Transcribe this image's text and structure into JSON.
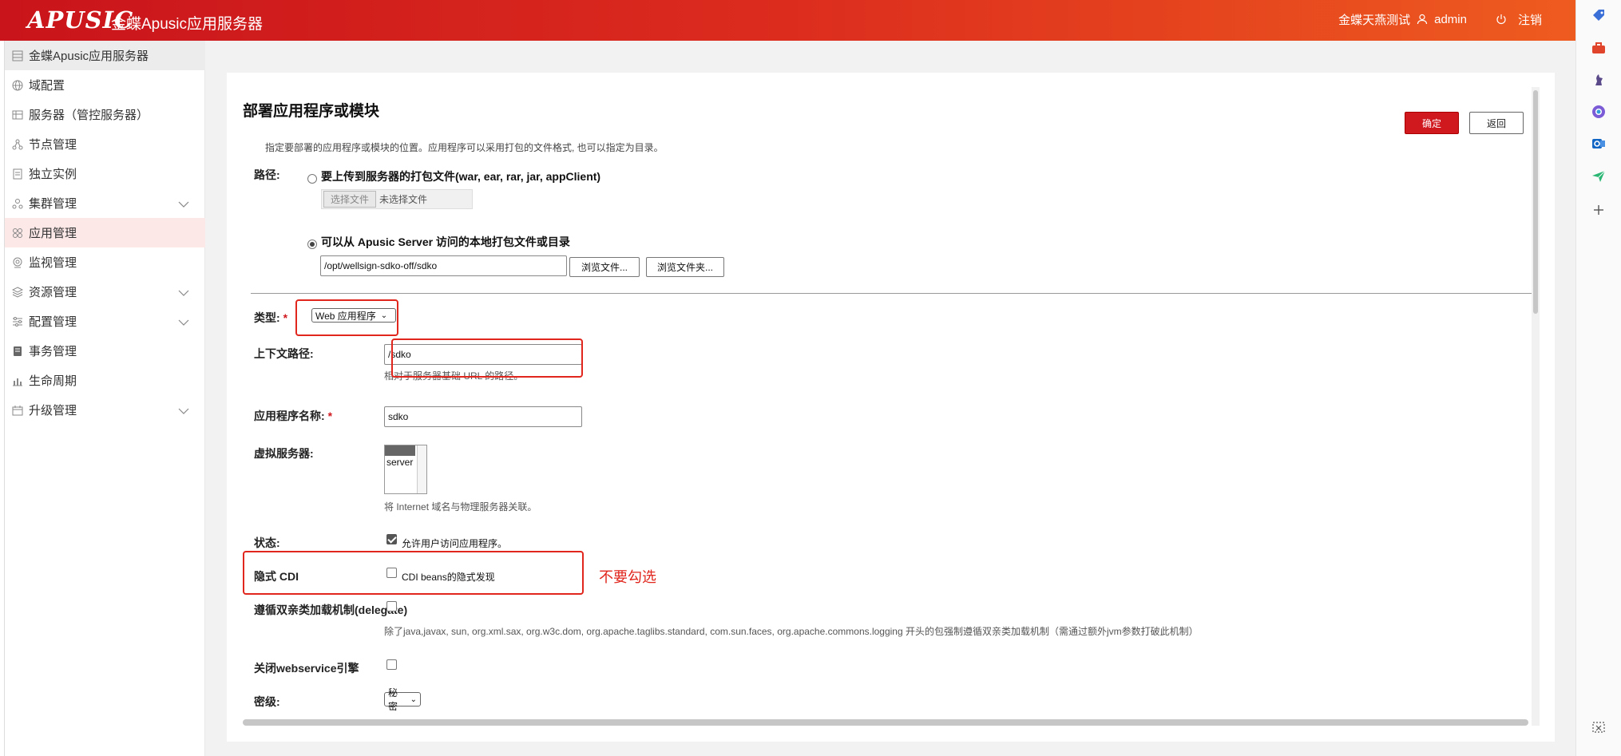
{
  "header": {
    "logo": "APUSIC",
    "title": "金蝶Apusic应用服务器",
    "org": "金蝶天燕测试",
    "user": "admin",
    "logout": "注销"
  },
  "sidebar": {
    "items": [
      {
        "label": "金蝶Apusic应用服务器",
        "icon": "server-icon"
      },
      {
        "label": "域配置",
        "icon": "globe-icon"
      },
      {
        "label": "服务器（管控服务器）",
        "icon": "table-icon"
      },
      {
        "label": "节点管理",
        "icon": "nodes-icon"
      },
      {
        "label": "独立实例",
        "icon": "instance-icon"
      },
      {
        "label": "集群管理",
        "icon": "cluster-icon",
        "expandable": true
      },
      {
        "label": "应用管理",
        "icon": "apps-icon",
        "active": true
      },
      {
        "label": "监视管理",
        "icon": "monitor-icon"
      },
      {
        "label": "资源管理",
        "icon": "layers-icon",
        "expandable": true
      },
      {
        "label": "配置管理",
        "icon": "sliders-icon",
        "expandable": true
      },
      {
        "label": "事务管理",
        "icon": "transaction-icon"
      },
      {
        "label": "生命周期",
        "icon": "chart-icon"
      },
      {
        "label": "升级管理",
        "icon": "upgrade-icon",
        "expandable": true
      }
    ]
  },
  "page": {
    "title": "部署应用程序或模块",
    "description": "指定要部署的应用程序或模块的位置。应用程序可以采用打包的文件格式, 也可以指定为目录。",
    "ok_button": "确定",
    "back_button": "返回"
  },
  "form": {
    "path_label": "路径:",
    "upload_option": "要上传到服务器的打包文件(war, ear, rar, jar, appClient)",
    "choose_file": "选择文件",
    "no_file": "未选择文件",
    "local_option": "可以从 Apusic Server 访问的本地打包文件或目录",
    "local_path": "/opt/wellsign-sdko-off/sdko",
    "browse_file": "浏览文件...",
    "browse_folder": "浏览文件夹...",
    "type_label": "类型:",
    "type_value": "Web 应用程序",
    "context_label": "上下文路径:",
    "context_value": "/sdko",
    "context_hint": "相对于服务器基础 URL 的路径。",
    "appname_label": "应用程序名称:",
    "appname_value": "sdko",
    "vserver_label": "虚拟服务器:",
    "vserver_option": "server",
    "vserver_hint": "将 Internet 域名与物理服务器关联。",
    "status_label": "状态:",
    "status_cb": "允许用户访问应用程序。",
    "status_checked": true,
    "cdi_label": "隐式 CDI",
    "cdi_cb": "CDI beans的隐式发现",
    "cdi_checked": false,
    "delegate_label": "遵循双亲类加载机制(delegate)",
    "delegate_hint": "除了java,javax, sun, org.xml.sax, org.w3c.dom, org.apache.taglibs.standard, com.sun.faces, org.apache.commons.logging 开头的包强制遵循双亲类加载机制（需通过额外jvm参数打破此机制）",
    "delegate_checked": false,
    "webservice_label": "关闭webservice引擎",
    "webservice_checked": false,
    "secret_label": "密级:",
    "secret_value": "秘密"
  },
  "annotation": "不要勾选",
  "colors": {
    "header_start": "#c9141b",
    "header_end": "#ee5b1f",
    "primary": "#d0181f",
    "highlight": "#e0261d"
  }
}
